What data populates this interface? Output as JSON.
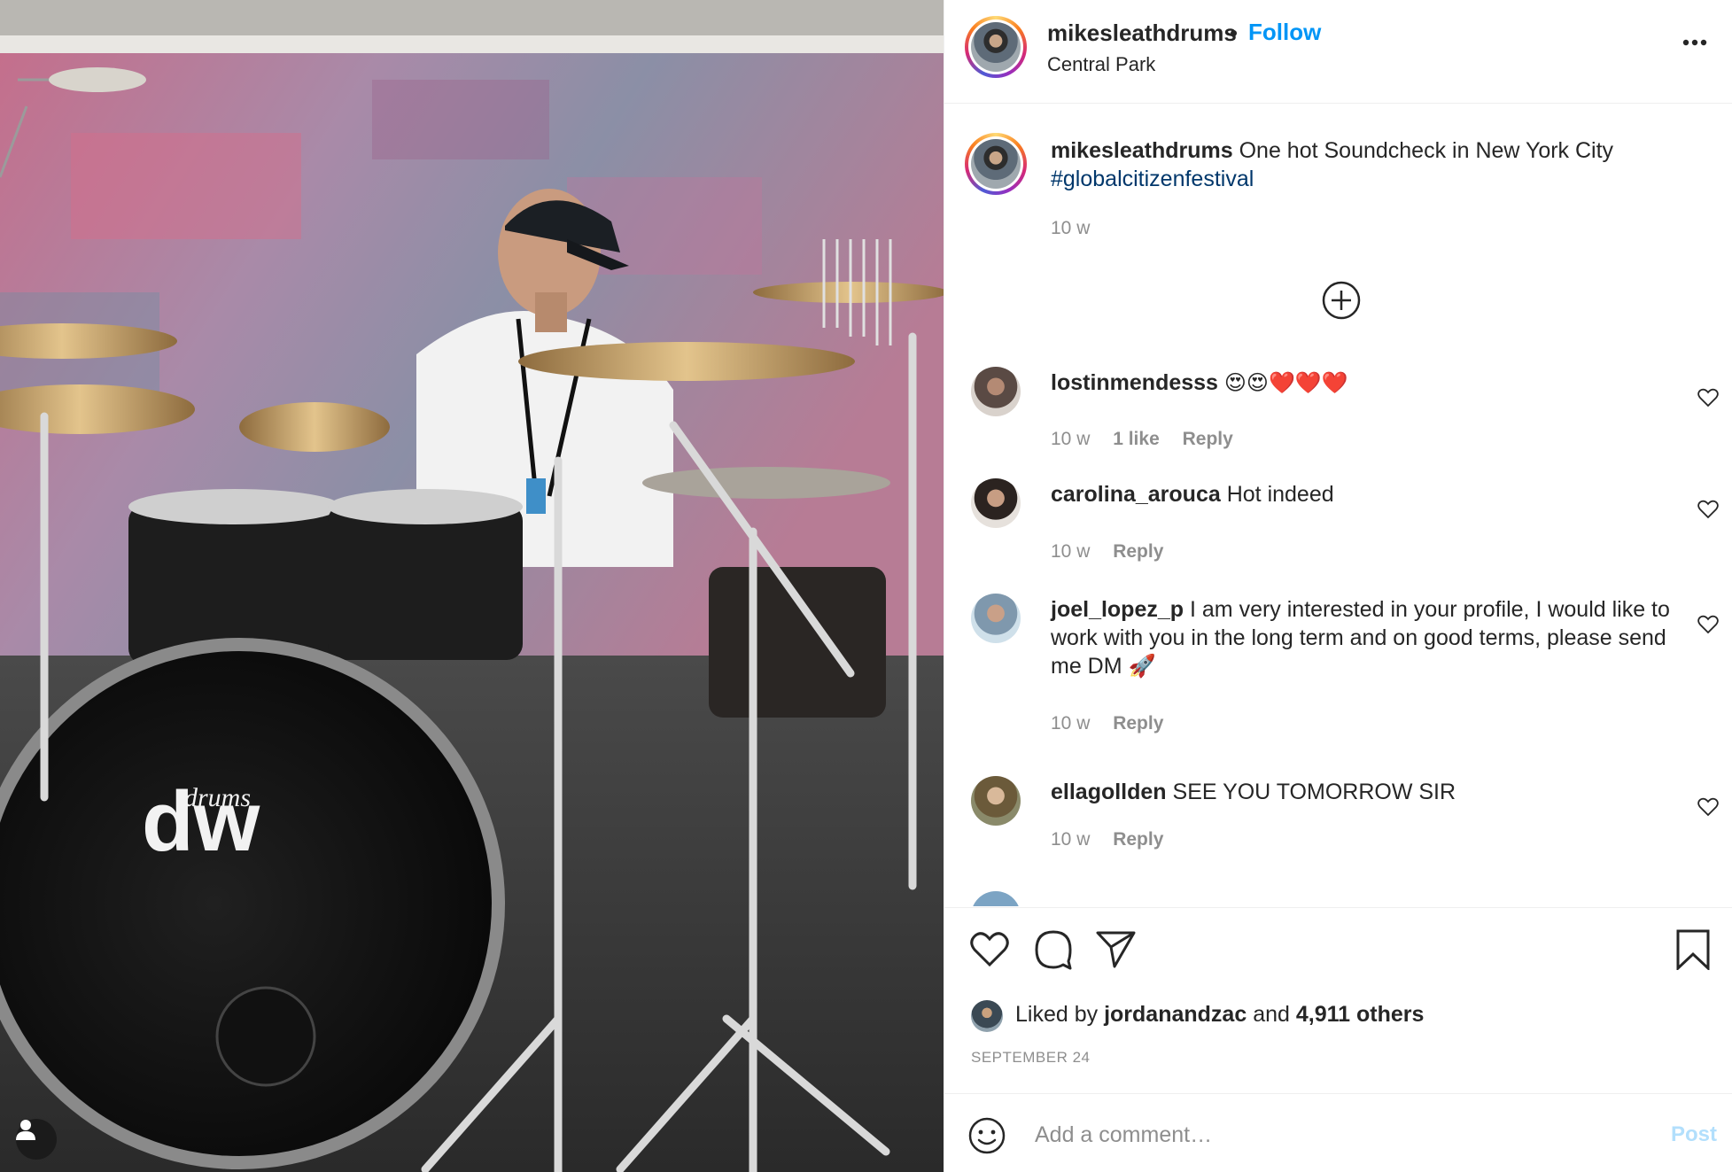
{
  "post": {
    "username": "mikesleathdrums",
    "separator": "•",
    "follow_label": "Follow",
    "location": "Central Park",
    "more_icon": "more-horizontal-icon"
  },
  "caption": {
    "username": "mikesleathdrums",
    "text": "One hot Soundcheck in New York City",
    "hashtag": "#globalcitizenfestival",
    "time": "10 w"
  },
  "load_more_icon": "plus-circle-icon",
  "comments": [
    {
      "username": "lostinmendesss",
      "text": "😍😍❤️❤️❤️",
      "time": "10 w",
      "likes": "1 like",
      "reply": "Reply"
    },
    {
      "username": "carolina_arouca",
      "text": "Hot indeed",
      "time": "10 w",
      "reply": "Reply"
    },
    {
      "username": "joel_lopez_p",
      "text": "I am very interested in your profile, I would like to work with you in the long term and on good terms, please send me DM 🚀",
      "time": "10 w",
      "reply": "Reply"
    },
    {
      "username": "ellagollden",
      "text": "SEE YOU TOMORROW SIR",
      "time": "10 w",
      "reply": "Reply"
    }
  ],
  "actions": {
    "like_icon": "heart-icon",
    "comment_icon": "comment-icon",
    "share_icon": "paper-plane-icon",
    "save_icon": "bookmark-icon"
  },
  "likes": {
    "prefix": "Liked by",
    "user": "jordanandzac",
    "conj": "and",
    "others": "4,911 others"
  },
  "date": "SEPTEMBER 24",
  "add_comment": {
    "placeholder": "Add a comment…",
    "post_label": "Post"
  },
  "colors": {
    "accent": "#0095f6",
    "text": "#262626",
    "muted": "#8e8e8e",
    "post_disabled": "#b2dffc"
  }
}
